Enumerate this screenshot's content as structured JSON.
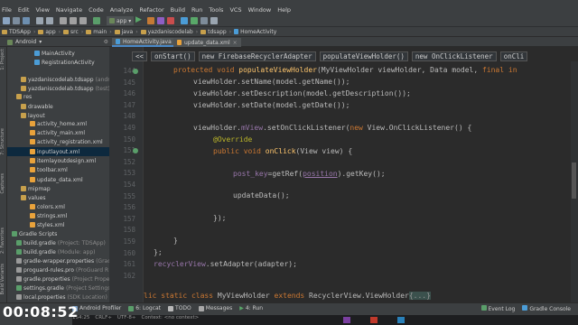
{
  "menu": [
    "File",
    "Edit",
    "View",
    "Navigate",
    "Code",
    "Analyze",
    "Refactor",
    "Build",
    "Run",
    "Tools",
    "VCS",
    "Window",
    "Help"
  ],
  "toolbar": {
    "run_config": "app"
  },
  "breadcrumbs": [
    "TDSApp",
    "app",
    "src",
    "main",
    "java",
    "yazdaniscodelab",
    "tdsapp",
    "HomeActivity"
  ],
  "project_panel": {
    "view": "Android"
  },
  "editor_tabs": [
    "HomeActivity.java",
    "update_data.xml"
  ],
  "project_tree": [
    {
      "text": "MainActivity",
      "depth": 6,
      "icon": "class"
    },
    {
      "text": "RegistrationActivity",
      "depth": 6,
      "icon": "class"
    },
    {
      "text": "yazdaniscodelab.tdsapp",
      "note": "(andr",
      "depth": 3,
      "icon": "package"
    },
    {
      "text": "yazdaniscodelab.tdsapp",
      "note": "(test)",
      "depth": 3,
      "icon": "package"
    },
    {
      "text": "res",
      "depth": 2,
      "icon": "folder"
    },
    {
      "text": "drawable",
      "depth": 3,
      "icon": "folder"
    },
    {
      "text": "layout",
      "depth": 3,
      "icon": "folder"
    },
    {
      "text": "activity_home.xml",
      "depth": 5,
      "icon": "xml"
    },
    {
      "text": "activity_main.xml",
      "depth": 5,
      "icon": "xml"
    },
    {
      "text": "activity_registration.xml",
      "depth": 5,
      "icon": "xml"
    },
    {
      "text": "inputlayout.xml",
      "depth": 5,
      "icon": "xml",
      "selected": true
    },
    {
      "text": "itemlayoutdesign.xml",
      "depth": 5,
      "icon": "xml"
    },
    {
      "text": "toolbar.xml",
      "depth": 5,
      "icon": "xml"
    },
    {
      "text": "update_data.xml",
      "depth": 5,
      "icon": "xml"
    },
    {
      "text": "mipmap",
      "depth": 3,
      "icon": "folder"
    },
    {
      "text": "values",
      "depth": 3,
      "icon": "folder"
    },
    {
      "text": "colors.xml",
      "depth": 5,
      "icon": "xml"
    },
    {
      "text": "strings.xml",
      "depth": 5,
      "icon": "xml"
    },
    {
      "text": "styles.xml",
      "depth": 5,
      "icon": "xml"
    },
    {
      "text": "Gradle Scripts",
      "depth": 1,
      "icon": "gradle"
    },
    {
      "text": "build.gradle",
      "note": "(Project: TDSApp)",
      "depth": 2,
      "icon": "gradle"
    },
    {
      "text": "build.gradle",
      "note": "(Module: app)",
      "depth": 2,
      "icon": "gradle"
    },
    {
      "text": "gradle-wrapper.properties",
      "note": "(Gradl",
      "depth": 2,
      "icon": "prop"
    },
    {
      "text": "proguard-rules.pro",
      "note": "(ProGuard R",
      "depth": 2,
      "icon": "prop"
    },
    {
      "text": "gradle.properties",
      "note": "(Project Prope",
      "depth": 2,
      "icon": "prop"
    },
    {
      "text": "settings.gradle",
      "note": "(Project Settings)",
      "depth": 2,
      "icon": "gradle"
    },
    {
      "text": "local.properties",
      "note": "(SDK Location)",
      "depth": 2,
      "icon": "prop"
    }
  ],
  "left_tool_tabs": [
    "1: Project",
    "7: Structure",
    "Captures",
    "Build Variants",
    "2: Favorites"
  ],
  "code_breadcrumbs": [
    "<<",
    "onStart()",
    "new FirebaseRecyclerAdapter",
    "populateViewHolder()",
    "new OnClickListener",
    "onCli"
  ],
  "line_numbers": [
    "144",
    "145",
    "146",
    "147",
    "148",
    "149",
    "150",
    "151",
    "152",
    "153",
    "154",
    "155",
    "156",
    "157",
    "158",
    "159",
    "160",
    "161",
    "162"
  ],
  "code": {
    "l144": {
      "kw": "protected void ",
      "fn": "populateViewHolder",
      "rest": "(MyViewHolder viewHolder, Data model, ",
      "kw2": "final in"
    },
    "l145": "viewHolder.setName(model.getName());",
    "l146": "viewHolder.setDescription(model.getDescription());",
    "l147": "viewHolder.setDate(model.getDate());",
    "l149": {
      "a": "viewHolder.",
      "fld": "mView",
      "b": ".setOnClickListener(",
      "kw": "new ",
      "c": "View.OnClickListener() {"
    },
    "l150": "@Override",
    "l151": {
      "kw": "public void ",
      "fn": "onClick",
      "rest": "(View view) {"
    },
    "l153": {
      "fld": "post_key",
      "a": "=getRef(",
      "pp": "position",
      "b": ").getKey();"
    },
    "l155": "updateData();",
    "l157": "});",
    "l159": "}",
    "l160": "};",
    "l161": {
      "fld": "recyclerView",
      "rest": ".setAdapter(adapter);"
    },
    "l163": {
      "kw": "lic static class ",
      "rest": "MyViewHolder ",
      "kw2": "extends ",
      "rest2": "RecyclerView.ViewHolder",
      "fold": "{...}"
    }
  },
  "bottom_tools": [
    "Android Profiler",
    "6: Logcat",
    "TODO",
    "Messages",
    "4: Run"
  ],
  "right_status": [
    "Event Log",
    "Gradle Console"
  ],
  "status_line": [
    "154:25",
    "CRLF÷",
    "UTF-8÷",
    "Context: <no context>"
  ],
  "timer": "00:08:52",
  "colors": {
    "bg": "#2b2b2b",
    "panel": "#3c3f41",
    "keyword": "#cc7832",
    "method": "#ffc66d",
    "field": "#9876aa",
    "annotation": "#bbb529"
  }
}
